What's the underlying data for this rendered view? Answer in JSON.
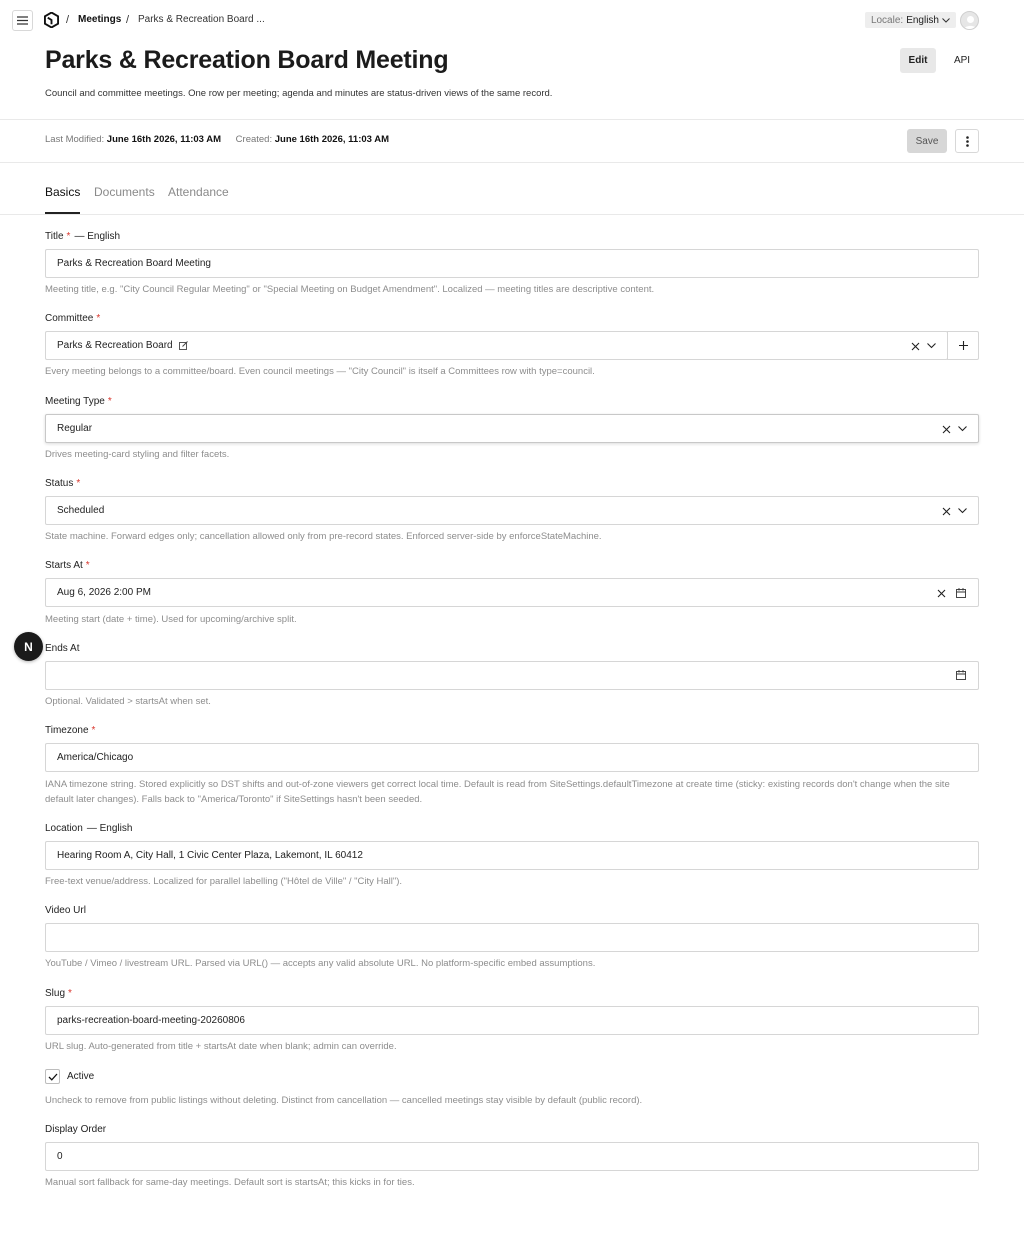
{
  "breadcrumb": {
    "separator": "/",
    "items": [
      "Meetings",
      "Parks & Recreation Board ..."
    ]
  },
  "locale": {
    "label": "Locale:",
    "value": "English"
  },
  "page": {
    "title": "Parks & Recreation Board Meeting",
    "description": "Council and committee meetings. One row per meeting; agenda and minutes are status-driven views of the same record.",
    "edit_label": "Edit",
    "api_label": "API"
  },
  "meta": {
    "modified_label": "Last Modified:",
    "modified_value": "June 16th 2026, 11:03 AM",
    "created_label": "Created:",
    "created_value": "June 16th 2026, 11:03 AM",
    "save_label": "Save"
  },
  "tabs": [
    {
      "label": "Basics",
      "active": true
    },
    {
      "label": "Documents",
      "active": false
    },
    {
      "label": "Attendance",
      "active": false
    }
  ],
  "fields": {
    "title": {
      "label": "Title",
      "required": "*",
      "locale": "— English",
      "value": "Parks & Recreation Board Meeting",
      "help": "Meeting title, e.g. \"City Council Regular Meeting\" or \"Special Meeting on Budget Amendment\". Localized — meeting titles are descriptive content."
    },
    "committee": {
      "label": "Committee",
      "required": "*",
      "value": "Parks & Recreation Board",
      "help": "Every meeting belongs to a committee/board. Even council meetings — \"City Council\" is itself a Committees row with type=council."
    },
    "meeting_type": {
      "label": "Meeting Type",
      "required": "*",
      "value": "Regular",
      "help": "Drives meeting-card styling and filter facets."
    },
    "status": {
      "label": "Status",
      "required": "*",
      "value": "Scheduled",
      "help": "State machine. Forward edges only; cancellation allowed only from pre-record states. Enforced server-side by enforceStateMachine."
    },
    "starts_at": {
      "label": "Starts At",
      "required": "*",
      "value": "Aug 6, 2026 2:00 PM",
      "help": "Meeting start (date + time). Used for upcoming/archive split."
    },
    "ends_at": {
      "label": "Ends At",
      "value": "",
      "help": "Optional. Validated > startsAt when set."
    },
    "timezone": {
      "label": "Timezone",
      "required": "*",
      "value": "America/Chicago",
      "help": "IANA timezone string. Stored explicitly so DST shifts and out-of-zone viewers get correct local time. Default is read from SiteSettings.defaultTimezone at create time (sticky: existing records don't change when the site default later changes). Falls back to \"America/Toronto\" if SiteSettings hasn't been seeded."
    },
    "location": {
      "label": "Location",
      "locale": "— English",
      "value": "Hearing Room A, City Hall, 1 Civic Center Plaza, Lakemont, IL 60412",
      "help": "Free-text venue/address. Localized for parallel labelling (\"Hôtel de Ville\" / \"City Hall\")."
    },
    "video_url": {
      "label": "Video Url",
      "value": "",
      "help": "YouTube / Vimeo / livestream URL. Parsed via URL() — accepts any valid absolute URL. No platform-specific embed assumptions."
    },
    "slug": {
      "label": "Slug",
      "required": "*",
      "value": "parks-recreation-board-meeting-20260806",
      "help": "URL slug. Auto-generated from title + startsAt date when blank; admin can override."
    },
    "active": {
      "label": "Active",
      "checked": true,
      "help": "Uncheck to remove from public listings without deleting. Distinct from cancellation — cancelled meetings stay visible by default (public record)."
    },
    "display_order": {
      "label": "Display Order",
      "value": "0",
      "help": "Manual sort fallback for same-day meetings. Default sort is startsAt; this kicks in for ties."
    }
  },
  "floating_badge": {
    "label": "N"
  },
  "icons": {
    "menu": "hamburger-icon",
    "logo": "payload-logo-icon",
    "chevron": "chevron-down-icon",
    "clear": "x-icon",
    "calendar": "calendar-icon",
    "edit": "edit-icon",
    "plus": "plus-icon",
    "kebab": "kebab-icon",
    "check": "check-icon"
  },
  "colors": {
    "required": "#d9342b",
    "help_text": "#8d8d8d",
    "accent": "#222222"
  }
}
